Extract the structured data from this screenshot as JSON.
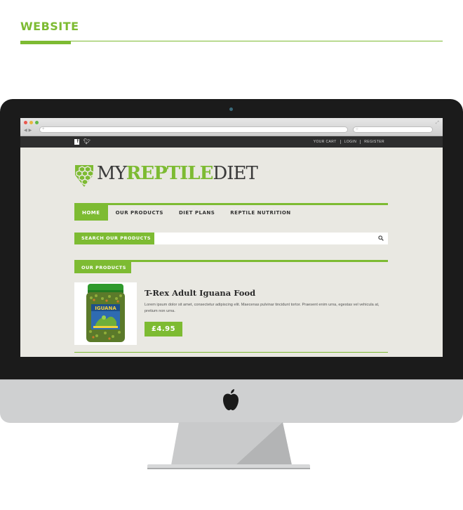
{
  "header": {
    "title": "WEBSITE"
  },
  "colors": {
    "accent": "#7dbb32",
    "topbar": "#2e2e2e",
    "page_bg": "#e9e8e2"
  },
  "browser": {
    "traffic_lights": [
      "red",
      "yellow",
      "green"
    ]
  },
  "site": {
    "topbar": {
      "social": [
        "facebook-icon",
        "twitter-icon"
      ],
      "links": [
        "YOUR CART",
        "LOGIN",
        "REGISTER"
      ]
    },
    "logo": {
      "my": "MY",
      "reptile": "REPTILE",
      "diet": "DIET"
    },
    "nav": [
      "HOME",
      "OUR PRODUCTS",
      "DIET PLANS",
      "REPTILE NUTRITION"
    ],
    "search": {
      "label": "SEARCH OUR PRODUCTS",
      "placeholder": ""
    },
    "products_section": {
      "label": "OUR PRODUCTS"
    },
    "product": {
      "title": "T-Rex Adult Iguana Food",
      "description": "Lorem ipsum dolor sit amet, consectetur adipiscing elit. Maecenas pulvinar tincidunt tortor. Praesent enim urna, egestas vel vehicula at, pretium non urna.",
      "price": "£4.95",
      "jar_label": "IGUANA"
    }
  }
}
